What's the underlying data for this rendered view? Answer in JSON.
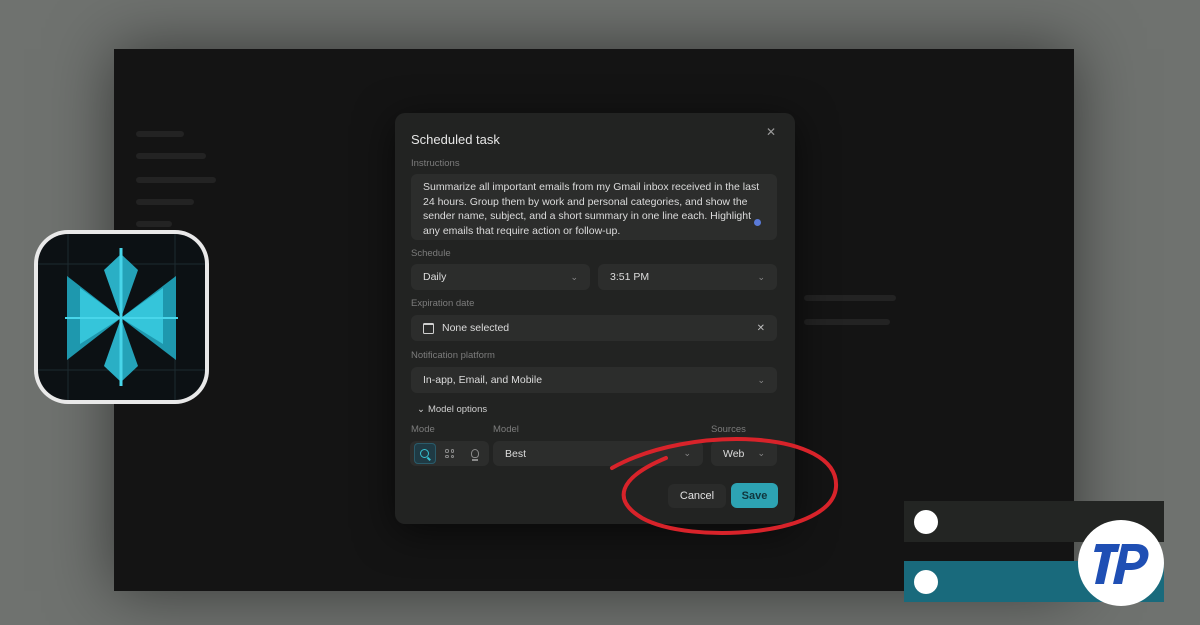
{
  "dialog": {
    "title": "Scheduled task",
    "instructions_label": "Instructions",
    "instructions_text": "Summarize all important emails from my Gmail inbox received in the last 24 hours. Group them by work and personal categories, and show the sender name, subject, and a short summary in one line each. Highlight any emails that require action or follow-up.",
    "schedule_label": "Schedule",
    "schedule_frequency": "Daily",
    "schedule_time": "3:51 PM",
    "expiration_label": "Expiration date",
    "expiration_value": "None selected",
    "notification_label": "Notification platform",
    "notification_value": "In-app, Email, and Mobile",
    "model_options_label": "Model options",
    "mode_label": "Mode",
    "model_label": "Model",
    "model_value": "Best",
    "sources_label": "Sources",
    "sources_value": "Web",
    "cancel_label": "Cancel",
    "save_label": "Save"
  },
  "icons": [
    "close-icon",
    "chevron-down-icon",
    "calendar-icon",
    "search-icon",
    "grid-icon",
    "lightbulb-icon",
    "app-logo-icon",
    "tp-logo"
  ],
  "colors": {
    "accent": "#2da3b3",
    "annotation": "#d8232a",
    "background": "#141414",
    "dialog": "#222322"
  }
}
